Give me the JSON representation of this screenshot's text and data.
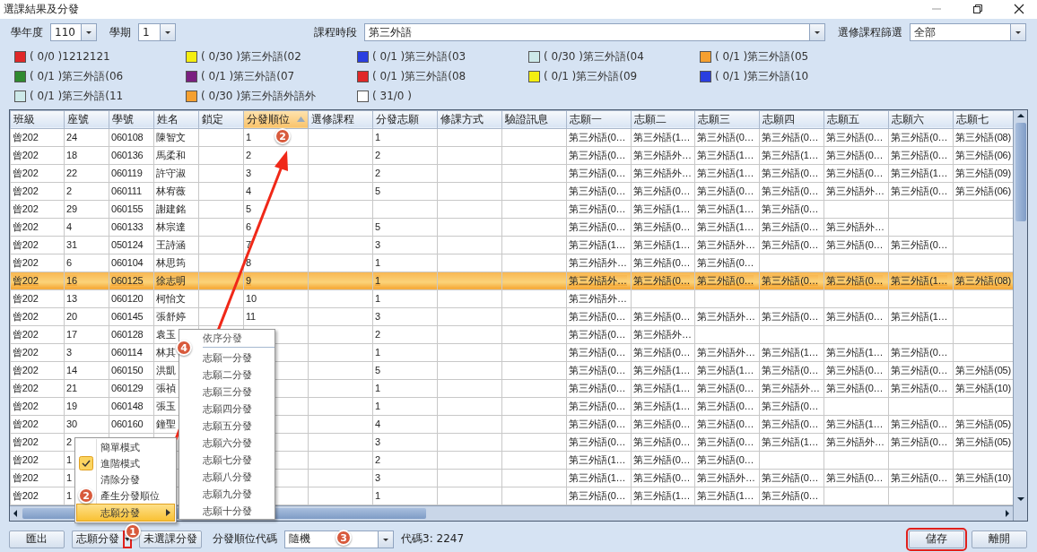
{
  "window": {
    "title": "選課結果及分發"
  },
  "filters": [
    {
      "label": "學年度",
      "value": "110"
    },
    {
      "label": "學期",
      "value": "1"
    },
    {
      "label": "課程時段",
      "value": "第三外語"
    },
    {
      "label": "選修課程篩選",
      "value": "全部"
    }
  ],
  "legend": [
    {
      "text": "( 0/0 )1212121",
      "color": "#e02828"
    },
    {
      "text": "( 0/30 )第三外語(02",
      "color": "#f4ee10"
    },
    {
      "text": "( 0/1 )第三外語(03",
      "color": "#2a3ee0"
    },
    {
      "text": "( 0/30 )第三外語(04",
      "color": "#cde9e9"
    },
    {
      "text": "( 0/1 )第三外語(05",
      "color": "#f5a030"
    },
    {
      "text": "( 0/1 )第三外語(06",
      "color": "#2f8a2f"
    },
    {
      "text": "( 0/1 )第三外語(07",
      "color": "#7a2080"
    },
    {
      "text": "( 0/1 )第三外語(08",
      "color": "#e02828"
    },
    {
      "text": "( 0/1 )第三外語(09",
      "color": "#f4ee10"
    },
    {
      "text": "( 0/1 )第三外語(10",
      "color": "#2a3ee0"
    },
    {
      "text": "( 0/1 )第三外語(11",
      "color": "#cde9e9"
    },
    {
      "text": "( 0/30 )第三外語外語外",
      "color": "#f5a030"
    },
    {
      "text": "( 31/0 )",
      "color": "#ffffff"
    }
  ],
  "table": {
    "columns": [
      {
        "label": "班級",
        "sorted": false
      },
      {
        "label": "座號",
        "sorted": false
      },
      {
        "label": "學號",
        "sorted": false
      },
      {
        "label": "姓名",
        "sorted": false
      },
      {
        "label": "鎖定",
        "sorted": false
      },
      {
        "label": "分發順位",
        "sorted": true
      },
      {
        "label": "選修課程",
        "sorted": false
      },
      {
        "label": "分發志願",
        "sorted": false
      },
      {
        "label": "修課方式",
        "sorted": false
      },
      {
        "label": "驗證訊息",
        "sorted": false
      },
      {
        "label": "志願一",
        "sorted": false
      },
      {
        "label": "志願二",
        "sorted": false
      },
      {
        "label": "志願三",
        "sorted": false
      },
      {
        "label": "志願四",
        "sorted": false
      },
      {
        "label": "志願五",
        "sorted": false
      },
      {
        "label": "志願六",
        "sorted": false
      },
      {
        "label": "志願七",
        "sorted": false
      }
    ],
    "rows": [
      {
        "selected": false,
        "cells": [
          "曾202",
          "24",
          "060108",
          "陳智文",
          null,
          "1",
          null,
          "1",
          null,
          null,
          "第三外語(0…",
          "第三外語(1…",
          "第三外語(0…",
          "第三外語(0…",
          "第三外語(0…",
          "第三外語(0…",
          "第三外語(08)"
        ]
      },
      {
        "selected": false,
        "cells": [
          "曾202",
          "18",
          "060136",
          "馬柔和",
          null,
          "2",
          null,
          "2",
          null,
          null,
          "第三外語(0…",
          "第三外語外…",
          "第三外語(1…",
          "第三外語(1…",
          "第三外語(0…",
          "第三外語(0…",
          "第三外語(06)"
        ]
      },
      {
        "selected": false,
        "cells": [
          "曾202",
          "22",
          "060119",
          "許守淑",
          null,
          "3",
          null,
          "2",
          null,
          null,
          "第三外語(0…",
          "第三外語外…",
          "第三外語(1…",
          "第三外語(0…",
          "第三外語(0…",
          "第三外語(1…",
          "第三外語(09)"
        ]
      },
      {
        "selected": false,
        "cells": [
          "曾202",
          "2",
          "060111",
          "林宥薇",
          null,
          "4",
          null,
          "5",
          null,
          null,
          "第三外語(0…",
          "第三外語(0…",
          "第三外語(0…",
          "第三外語(0…",
          "第三外語外…",
          "第三外語(0…",
          "第三外語(06)"
        ]
      },
      {
        "selected": false,
        "cells": [
          "曾202",
          "29",
          "060155",
          "謝建銘",
          null,
          "5",
          null,
          null,
          null,
          null,
          "第三外語(0…",
          "第三外語(1…",
          "第三外語(1…",
          "第三外語(0…",
          null,
          null,
          null
        ]
      },
      {
        "selected": false,
        "cells": [
          "曾202",
          "4",
          "060133",
          "林宗達",
          null,
          "6",
          null,
          "5",
          null,
          null,
          "第三外語(0…",
          "第三外語(0…",
          "第三外語(1…",
          "第三外語(0…",
          "第三外語外…",
          null,
          null
        ]
      },
      {
        "selected": false,
        "cells": [
          "曾202",
          "31",
          "050124",
          "王詩涵",
          null,
          "7",
          null,
          "3",
          null,
          null,
          "第三外語(1…",
          "第三外語(1…",
          "第三外語外…",
          "第三外語(0…",
          "第三外語(0…",
          "第三外語(0…",
          null
        ]
      },
      {
        "selected": false,
        "cells": [
          "曾202",
          "6",
          "060104",
          "林思筠",
          null,
          "8",
          null,
          "1",
          null,
          null,
          "第三外語外…",
          "第三外語(0…",
          "第三外語(0…",
          null,
          null,
          null,
          null
        ]
      },
      {
        "selected": true,
        "cells": [
          "曾202",
          "16",
          "060125",
          "徐志明",
          null,
          "9",
          null,
          "1",
          null,
          null,
          "第三外語外…",
          "第三外語(0…",
          "第三外語(0…",
          "第三外語(0…",
          "第三外語(0…",
          "第三外語(1…",
          "第三外語(08)"
        ]
      },
      {
        "selected": false,
        "cells": [
          "曾202",
          "13",
          "060120",
          "柯怡文",
          null,
          "10",
          null,
          "1",
          null,
          null,
          "第三外語外…",
          null,
          null,
          null,
          null,
          null,
          null
        ]
      },
      {
        "selected": false,
        "cells": [
          "曾202",
          "20",
          "060145",
          "張舒婷",
          null,
          "11",
          null,
          "3",
          null,
          null,
          "第三外語(0…",
          "第三外語(0…",
          "第三外語外…",
          "第三外語(0…",
          "第三外語(0…",
          "第三外語(1…",
          null
        ]
      },
      {
        "selected": false,
        "cells": [
          "曾202",
          "17",
          "060128",
          "袁玉",
          null,
          null,
          null,
          "2",
          null,
          null,
          "第三外語(0…",
          "第三外語外…",
          null,
          null,
          null,
          null,
          null
        ]
      },
      {
        "selected": false,
        "cells": [
          "曾202",
          "3",
          "060114",
          "林其",
          null,
          null,
          null,
          "1",
          null,
          null,
          "第三外語(0…",
          "第三外語(0…",
          "第三外語外…",
          "第三外語(1…",
          "第三外語(1…",
          "第三外語(0…",
          null
        ]
      },
      {
        "selected": false,
        "cells": [
          "曾202",
          "14",
          "060150",
          "洪凱",
          null,
          null,
          null,
          "5",
          null,
          null,
          "第三外語(0…",
          "第三外語(1…",
          "第三外語(1…",
          "第三外語(0…",
          "第三外語(0…",
          "第三外語(0…",
          "第三外語(05)"
        ]
      },
      {
        "selected": false,
        "cells": [
          "曾202",
          "21",
          "060129",
          "張禎",
          null,
          null,
          null,
          "1",
          null,
          null,
          "第三外語(0…",
          "第三外語(1…",
          "第三外語(0…",
          "第三外語外…",
          "第三外語(0…",
          "第三外語(0…",
          "第三外語(10)"
        ]
      },
      {
        "selected": false,
        "cells": [
          "曾202",
          "19",
          "060148",
          "張玉",
          null,
          null,
          null,
          "1",
          null,
          null,
          "第三外語(0…",
          "第三外語(1…",
          "第三外語(0…",
          "第三外語(0…",
          null,
          null,
          null
        ]
      },
      {
        "selected": false,
        "cells": [
          "曾202",
          "30",
          "060160",
          "鐘聖",
          null,
          null,
          null,
          "4",
          null,
          null,
          "第三外語(0…",
          "第三外語(0…",
          "第三外語(0…",
          "第三外語(0…",
          "第三外語(1…",
          "第三外語(0…",
          "第三外語(05)"
        ]
      },
      {
        "selected": false,
        "cells": [
          "曾202",
          "2",
          null,
          null,
          null,
          null,
          null,
          "3",
          null,
          null,
          "第三外語(0…",
          "第三外語(0…",
          "第三外語(0…",
          "第三外語(1…",
          "第三外語外…",
          "第三外語(0…",
          "第三外語(05)"
        ]
      },
      {
        "selected": false,
        "cells": [
          "曾202",
          "1",
          null,
          null,
          null,
          null,
          null,
          "2",
          null,
          null,
          "第三外語(1…",
          "第三外語(0…",
          "第三外語(0…",
          null,
          null,
          null,
          null
        ]
      },
      {
        "selected": false,
        "cells": [
          "曾202",
          "1",
          null,
          null,
          null,
          null,
          null,
          "3",
          null,
          null,
          "第三外語(1…",
          "第三外語(0…",
          "第三外語外…",
          "第三外語(0…",
          "第三外語(0…",
          "第三外語(0…",
          "第三外語(10)"
        ]
      },
      {
        "selected": false,
        "cells": [
          "曾202",
          "1",
          null,
          null,
          null,
          null,
          null,
          "1",
          null,
          null,
          "第三外語(0…",
          "第三外語(1…",
          "第三外語(1…",
          "第三外語(0…",
          null,
          null,
          null
        ]
      }
    ]
  },
  "context_menu": {
    "items": [
      {
        "label": "簡單模式",
        "checked": false,
        "highlighted": false,
        "submenu": false
      },
      {
        "label": "進階模式",
        "checked": true,
        "highlighted": false,
        "submenu": false
      },
      {
        "label": "清除分發",
        "checked": false,
        "highlighted": false,
        "submenu": false
      },
      {
        "label": "產生分發順位",
        "checked": false,
        "highlighted": false,
        "submenu": false
      },
      {
        "label": "志願分發",
        "checked": false,
        "highlighted": true,
        "submenu": true
      }
    ]
  },
  "submenu": {
    "title": "依序分發",
    "items": [
      "志願一分發",
      "志願二分發",
      "志願三分發",
      "志願四分發",
      "志願五分發",
      "志願六分發",
      "志願七分發",
      "志願八分發",
      "志願九分發",
      "志願十分發"
    ]
  },
  "annotations": [
    "2",
    "4",
    "2",
    "1",
    "3"
  ],
  "bottom_bar": {
    "export_button": "匯出",
    "split_button": {
      "label": "志願分發",
      "highlighted": true
    },
    "unassigned_button": "未選課分發",
    "order_label": "分發順位代碼",
    "order_value": "隨機",
    "code_text": "代碼3: 2247",
    "buttons": [
      {
        "label": "儲存",
        "highlighted": true
      },
      {
        "label": "離開",
        "highlighted": false
      }
    ]
  }
}
